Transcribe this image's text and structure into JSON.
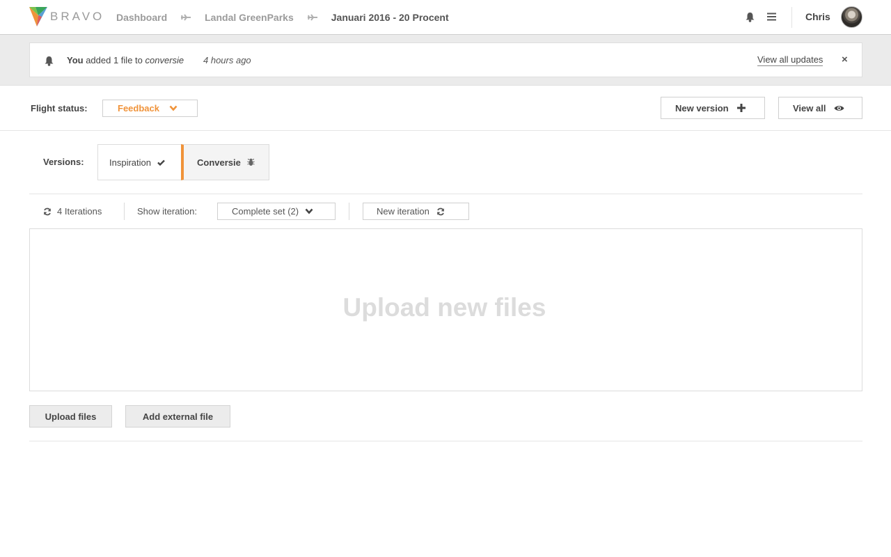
{
  "app": {
    "logo_text": "BRAVO"
  },
  "breadcrumb": [
    {
      "label": "Dashboard"
    },
    {
      "label": "Landal GreenParks"
    },
    {
      "label": "Januari 2016 - 20 Procent"
    }
  ],
  "user": {
    "name": "Chris"
  },
  "notification": {
    "actor": "You",
    "action": " added 1 file to ",
    "target": "conversie",
    "time": "4 hours ago",
    "link_label": "View all updates",
    "close_label": "×"
  },
  "flight": {
    "label": "Flight status:",
    "status_value": "Feedback",
    "status_color": "#f0933a"
  },
  "actions": {
    "new_version_label": "New version",
    "view_all_label": "View all"
  },
  "versions": {
    "label": "Versions:",
    "items": [
      {
        "label": "Inspiration",
        "icon": "check-icon"
      },
      {
        "label": "Conversie",
        "icon": "bug-icon"
      }
    ]
  },
  "iterations": {
    "count_label": "4 Iterations",
    "show_label": "Show iteration:",
    "selected": "Complete set (2)",
    "new_label": "New iteration"
  },
  "upload": {
    "placeholder": "Upload new files",
    "upload_button": "Upload files",
    "external_button": "Add external file"
  }
}
